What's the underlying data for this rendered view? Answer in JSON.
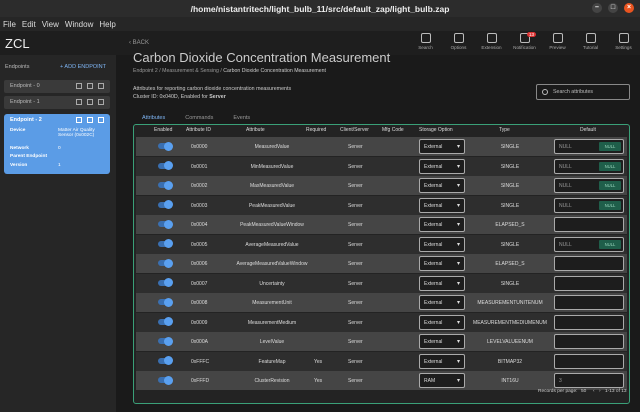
{
  "window": {
    "title": "/home/nistantritech/light_bulb_11/src/default_zap/light_bulb.zap"
  },
  "menu": [
    "File",
    "Edit",
    "View",
    "Window",
    "Help"
  ],
  "app": {
    "name": "ZCL",
    "back": "BACK"
  },
  "toolbar": [
    {
      "label": "Search",
      "icon": "search-icon"
    },
    {
      "label": "Options",
      "icon": "gear-icon"
    },
    {
      "label": "Extension",
      "icon": "puzzle-icon"
    },
    {
      "label": "Notification",
      "icon": "bell-icon",
      "badge": "13"
    },
    {
      "label": "Preview",
      "icon": "eye-icon"
    },
    {
      "label": "Tutorial",
      "icon": "book-icon"
    },
    {
      "label": "Settings",
      "icon": "gear-icon"
    }
  ],
  "sidebar": {
    "header": "Endpoints",
    "add_label": "+ ADD ENDPOINT",
    "endpoints": [
      {
        "label": "Endpoint - 0"
      },
      {
        "label": "Endpoint - 1"
      }
    ],
    "active": {
      "label": "Endpoint - 2",
      "device_key": "Device",
      "device_val": "Matter Air Quality Sensor (0x002C)",
      "network_key": "Network",
      "network_val": "0",
      "parent_key": "Parent Endpoint",
      "parent_val": "",
      "version_key": "Version",
      "version_val": "1"
    }
  },
  "page": {
    "title": "Carbon Dioxide Concentration Measurement",
    "breadcrumb": [
      "Endpoint 2",
      "Measurement & Sensing",
      "Carbon Dioxide Concentration Measurement"
    ],
    "desc1": "Attributes for reporting carbon dioxide concentration measurements",
    "desc2_prefix": "Cluster ID: 0x040D, Enabled for ",
    "desc2_strong": "Server",
    "search_placeholder": "Search attributes"
  },
  "tabs": [
    "Attributes",
    "Commands",
    "Events"
  ],
  "table": {
    "headers": [
      "Enabled",
      "Attribute ID",
      "Attribute",
      "Required",
      "Client/Server",
      "Mfg Code",
      "Storage Option",
      "Type",
      "Default"
    ],
    "rows": [
      {
        "id": "0x0000",
        "name": "MeasuredValue",
        "required": "",
        "side": "Server",
        "storage": "External",
        "type": "SINGLE",
        "default": "NULL",
        "null": "NULL"
      },
      {
        "id": "0x0001",
        "name": "MinMeasuredValue",
        "required": "",
        "side": "Server",
        "storage": "External",
        "type": "SINGLE",
        "default": "NULL",
        "null": "NULL"
      },
      {
        "id": "0x0002",
        "name": "MaxMeasuredValue",
        "required": "",
        "side": "Server",
        "storage": "External",
        "type": "SINGLE",
        "default": "NULL",
        "null": "NULL"
      },
      {
        "id": "0x0003",
        "name": "PeakMeasuredValue",
        "required": "",
        "side": "Server",
        "storage": "External",
        "type": "SINGLE",
        "default": "NULL",
        "null": "NULL"
      },
      {
        "id": "0x0004",
        "name": "PeakMeasuredValueWindow",
        "required": "",
        "side": "Server",
        "storage": "External",
        "type": "ELAPSED_S",
        "default": "",
        "null": ""
      },
      {
        "id": "0x0005",
        "name": "AverageMeasuredValue",
        "required": "",
        "side": "Server",
        "storage": "External",
        "type": "SINGLE",
        "default": "NULL",
        "null": "NULL"
      },
      {
        "id": "0x0006",
        "name": "AverageMeasuredValueWindow",
        "required": "",
        "side": "Server",
        "storage": "External",
        "type": "ELAPSED_S",
        "default": "",
        "null": ""
      },
      {
        "id": "0x0007",
        "name": "Uncertainty",
        "required": "",
        "side": "Server",
        "storage": "External",
        "type": "SINGLE",
        "default": "",
        "null": ""
      },
      {
        "id": "0x0008",
        "name": "MeasurementUnit",
        "required": "",
        "side": "Server",
        "storage": "External",
        "type": "MEASUREMENTUNITENUM",
        "default": "",
        "null": ""
      },
      {
        "id": "0x0009",
        "name": "MeasurementMedium",
        "required": "",
        "side": "Server",
        "storage": "External",
        "type": "MEASUREMENTMEDIUMENUM",
        "default": "",
        "null": ""
      },
      {
        "id": "0x000A",
        "name": "LevelValue",
        "required": "",
        "side": "Server",
        "storage": "External",
        "type": "LEVELVALUEENUM",
        "default": "",
        "null": ""
      },
      {
        "id": "0xFFFC",
        "name": "FeatureMap",
        "required": "Yes",
        "side": "Server",
        "storage": "External",
        "type": "BITMAP32",
        "default": "",
        "null": ""
      },
      {
        "id": "0xFFFD",
        "name": "ClusterRevision",
        "required": "Yes",
        "side": "Server",
        "storage": "RAM",
        "type": "INT16U",
        "default": "3",
        "null": ""
      }
    ]
  },
  "footer": {
    "rpp_label": "Records per page:",
    "rpp_value": "50",
    "range": "1-13 of 13"
  },
  "colors": {
    "accent": "#5b9ce6",
    "grid_border": "#3aa078"
  }
}
